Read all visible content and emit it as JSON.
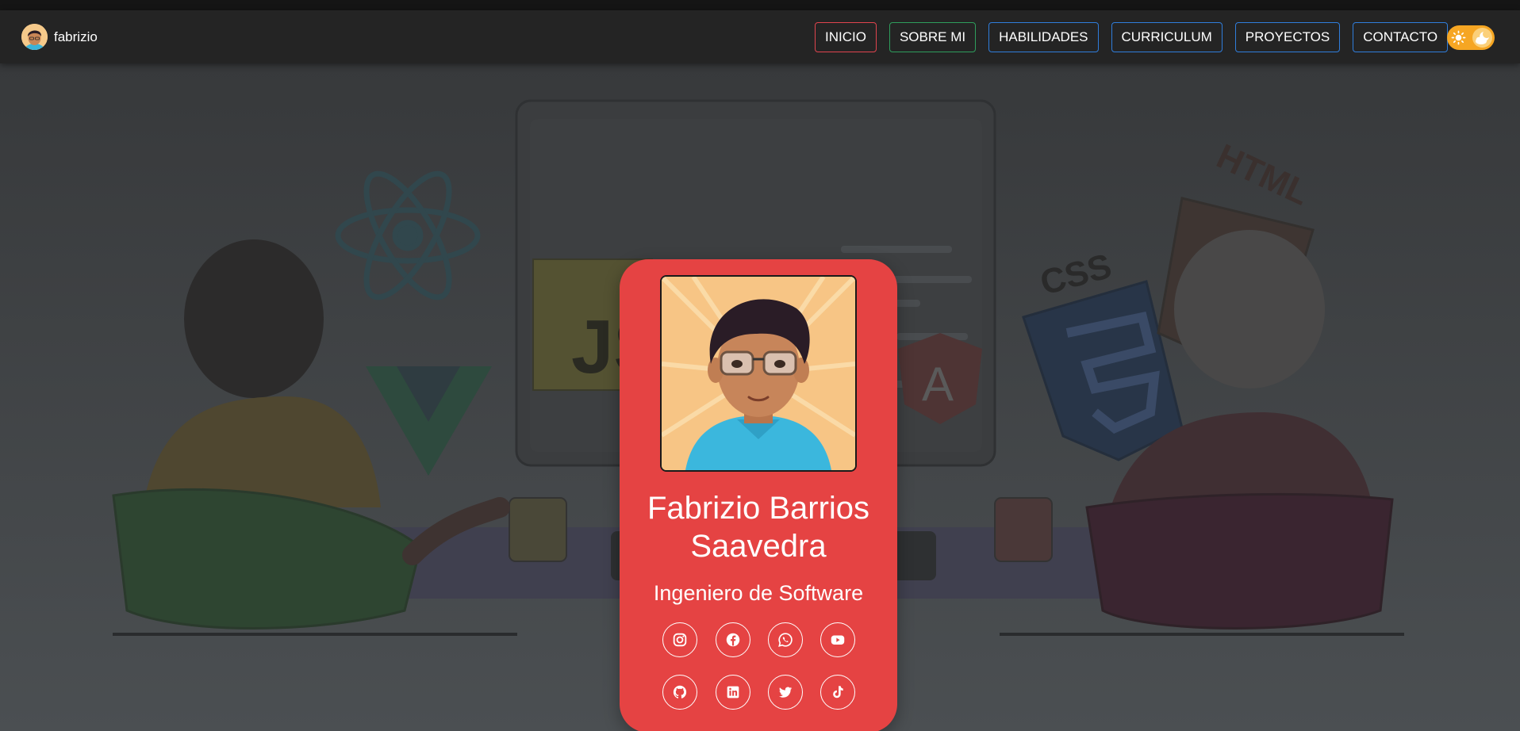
{
  "navbar": {
    "brand": "fabrizio",
    "links": [
      {
        "label": "INICIO",
        "color": "#e0444e"
      },
      {
        "label": "SOBRE MI",
        "color": "#2e9d5c"
      },
      {
        "label": "HABILIDADES",
        "color": "#2f7ddb"
      },
      {
        "label": "CURRICULUM",
        "color": "#2f7ddb"
      },
      {
        "label": "PROYECTOS",
        "color": "#2f7ddb"
      },
      {
        "label": "CONTACTO",
        "color": "#2f7ddb"
      }
    ],
    "theme_toggle": {
      "icons": [
        "sun-icon",
        "moon-cloud-icon"
      ],
      "color": "#f6a623"
    }
  },
  "card": {
    "name": "Fabrizio Barrios Saavedra",
    "role": "Ingeniero de Software",
    "background": "#e54343",
    "socials": [
      "instagram-icon",
      "facebook-icon",
      "whatsapp-icon",
      "youtube-icon",
      "github-icon",
      "linkedin-icon",
      "twitter-icon",
      "tiktok-icon"
    ]
  },
  "background_illustration": {
    "logos_text": [
      "JS",
      "CSS",
      "HTML",
      "A"
    ]
  },
  "colors": {
    "navbar": "#242424",
    "page": "#3f4245",
    "accent": "#e54343"
  }
}
